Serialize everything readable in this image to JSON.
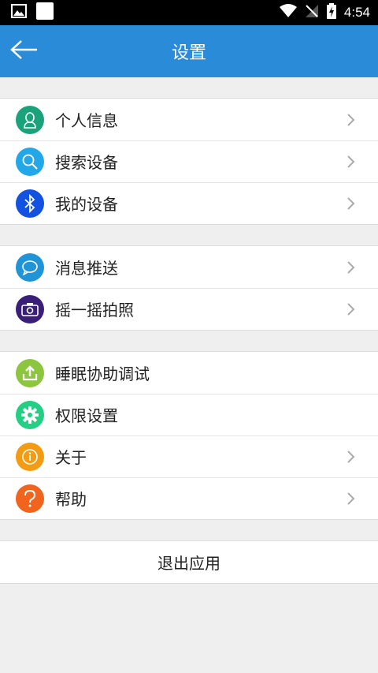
{
  "status_bar": {
    "time": "4:54"
  },
  "app_bar": {
    "title": "设置"
  },
  "groups": [
    {
      "items": [
        {
          "label": "个人信息",
          "icon": "person-icon",
          "color": "#1aa37a"
        },
        {
          "label": "搜索设备",
          "icon": "search-icon",
          "color": "#22a8e8"
        },
        {
          "label": "我的设备",
          "icon": "bluetooth-icon",
          "color": "#1351e0"
        }
      ]
    },
    {
      "items": [
        {
          "label": "消息推送",
          "icon": "chat-bubble-icon",
          "color": "#1f95d8"
        },
        {
          "label": "摇一摇拍照",
          "icon": "camera-icon",
          "color": "#3a1f78"
        }
      ]
    },
    {
      "items": [
        {
          "label": "睡眠协助调试",
          "icon": "upload-icon",
          "color": "#8cc63f"
        },
        {
          "label": "权限设置",
          "icon": "gear-icon",
          "color": "#22cf83"
        },
        {
          "label": "关于",
          "icon": "info-icon",
          "color": "#f39b12"
        },
        {
          "label": "帮助",
          "icon": "help-icon",
          "color": "#f0641e"
        }
      ]
    }
  ],
  "exit_label": "退出应用"
}
